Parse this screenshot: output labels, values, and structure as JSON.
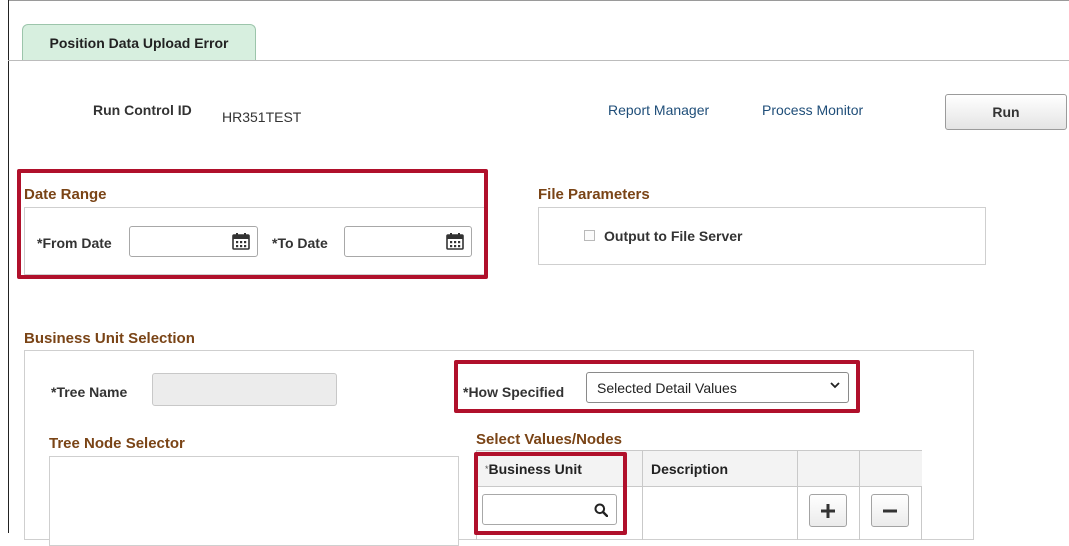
{
  "tab": {
    "label": "Position Data Upload Error"
  },
  "header": {
    "run_control_label": "Run Control ID",
    "run_control_value": "HR351TEST",
    "report_manager": "Report Manager",
    "process_monitor": "Process Monitor",
    "run_button": "Run"
  },
  "date_range": {
    "title": "Date Range",
    "from_label": "*From Date",
    "from_value": "",
    "to_label": "*To Date",
    "to_value": ""
  },
  "file_parameters": {
    "title": "File Parameters",
    "output_label": "Output to File Server",
    "output_checked": false
  },
  "business_unit": {
    "title": "Business Unit Selection",
    "tree_name_label": "*Tree Name",
    "tree_name_value": "",
    "how_specified_label": "*How Specified",
    "how_specified_value": "Selected Detail Values",
    "tree_node_title": "Tree Node Selector",
    "select_values_title": "Select Values/Nodes",
    "grid_headers": {
      "business_unit": "Business Unit",
      "description": "Description"
    },
    "grid_required_marker": "*",
    "rows": [
      {
        "business_unit": "",
        "description": ""
      }
    ]
  },
  "colors": {
    "highlight": "#b0102b",
    "section_title": "#7a4416",
    "link": "#1f4e79",
    "tab_bg": "#d7efdf"
  },
  "icons": [
    "calendar-icon",
    "search-icon",
    "plus-icon",
    "minus-icon",
    "chevron-down-icon"
  ]
}
